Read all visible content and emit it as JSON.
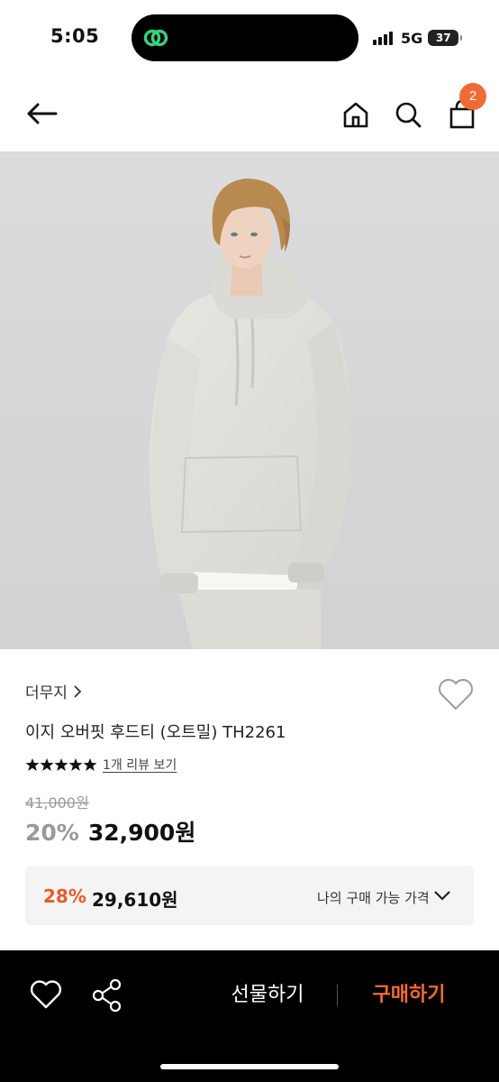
{
  "status_bar": {
    "time": "5:05",
    "network": "5G",
    "battery": "37",
    "island_app_color": "#2ecc71"
  },
  "header": {
    "icons": [
      "back-arrow-icon",
      "home-icon",
      "search-icon",
      "shopping-bag-icon"
    ],
    "cart_count": "2",
    "badge_color": "#f06a35"
  },
  "product": {
    "image_alt": "model wearing oatmeal oversized hoodie",
    "brand": "더무지",
    "name": "이지 오버핏 후드티 (오트밀) TH2261",
    "rating_stars": 5,
    "review_link": "1개 리뷰 보기",
    "original_price": "41,000원",
    "discount_rate": "20%",
    "sale_price": "32,900원",
    "my_price": {
      "rate": "28%",
      "price": "29,610원",
      "label": "나의 구매 가능 가격"
    }
  },
  "bottom_bar": {
    "gift_label": "선물하기",
    "buy_label": "구매하기",
    "accent_color": "#f06a35"
  }
}
